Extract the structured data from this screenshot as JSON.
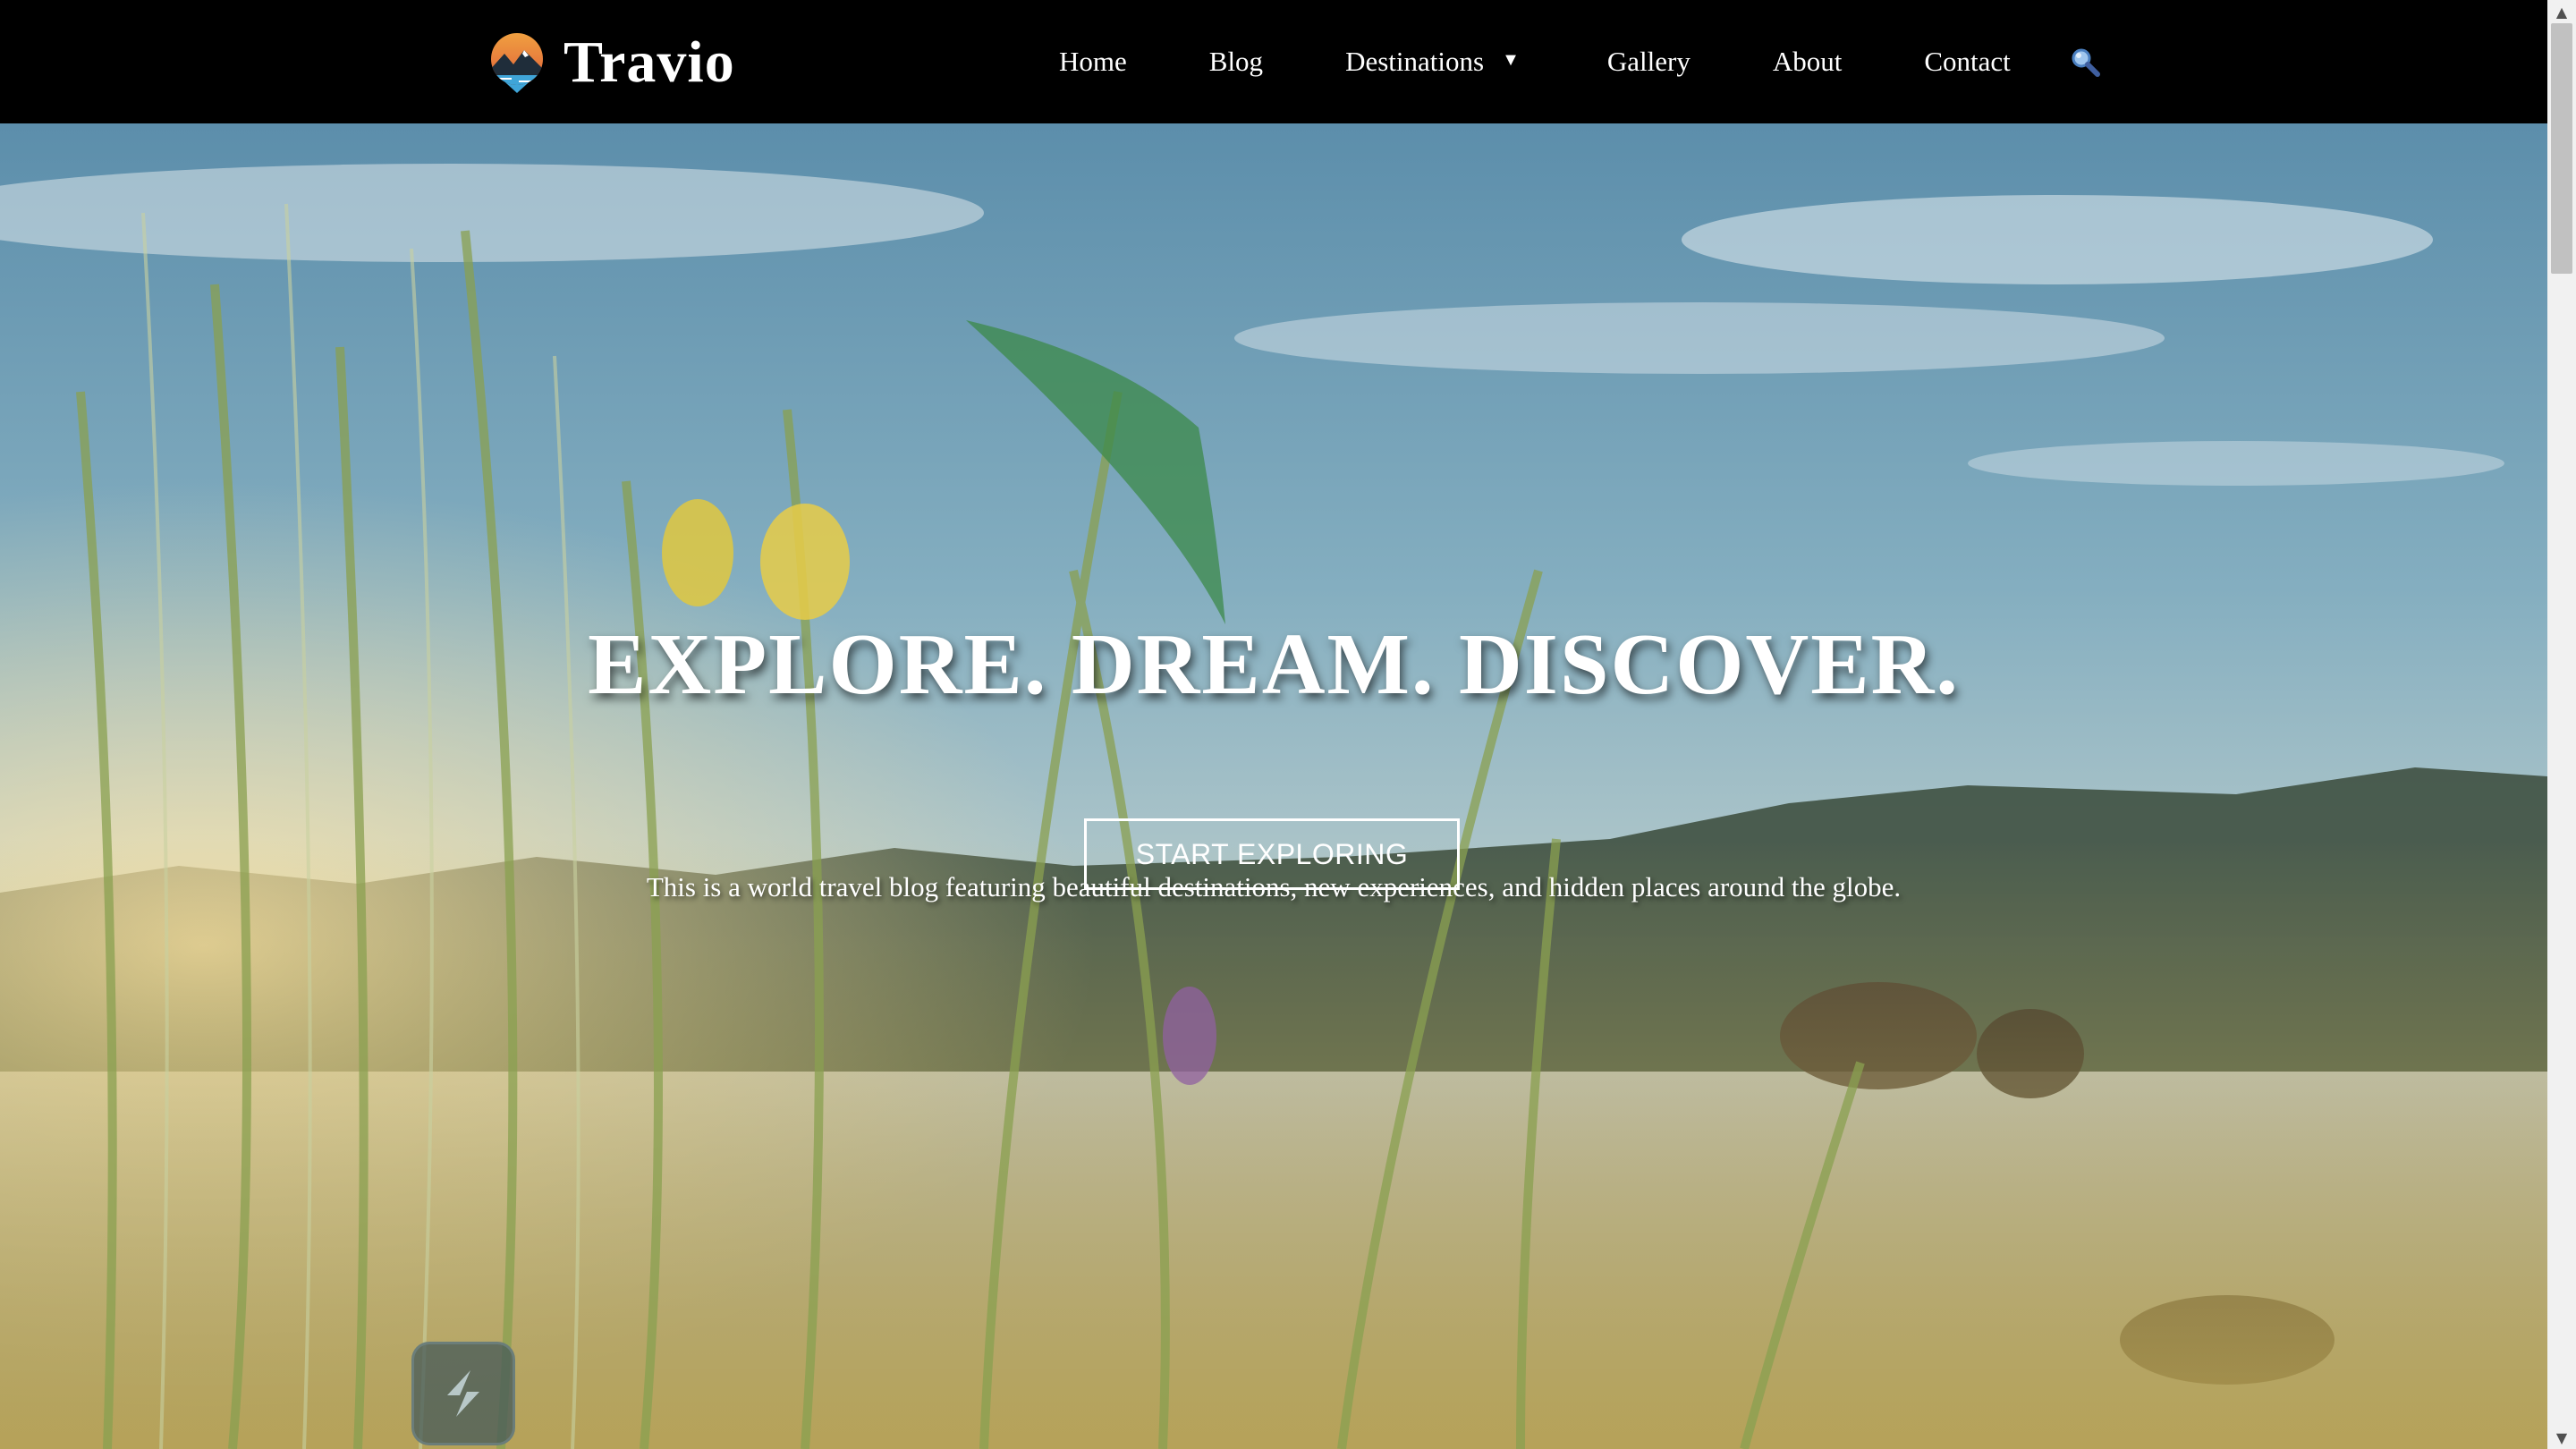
{
  "brand": {
    "name": "Travio",
    "logo_icon": "mountain-sun-logo-icon"
  },
  "nav": {
    "items": [
      {
        "label": "Home"
      },
      {
        "label": "Blog"
      },
      {
        "label": "Destinations",
        "has_dropdown": true,
        "caret": "▼"
      },
      {
        "label": "Gallery"
      },
      {
        "label": "About"
      },
      {
        "label": "Contact"
      }
    ],
    "search_icon": "magnifier-icon"
  },
  "hero": {
    "title": "EXPLORE. DREAM. DISCOVER.",
    "subtitle": "This is a world travel blog featuring beautiful destinations, new experiences, and hidden places around the globe.",
    "cta_label": "START EXPLORING",
    "background": "lake-meadow-at-sunrise-image"
  },
  "widget": {
    "icon": "slash-logo-icon"
  },
  "colors": {
    "navbar_bg": "#000000",
    "text": "#ffffff",
    "sky_top": "#5f8fab",
    "sky_mid": "#9dbcc6",
    "water": "#c8c4b4",
    "grass": "#b8a455"
  },
  "scrollbar": {
    "up_arrow": "▲",
    "down_arrow": "▼"
  }
}
